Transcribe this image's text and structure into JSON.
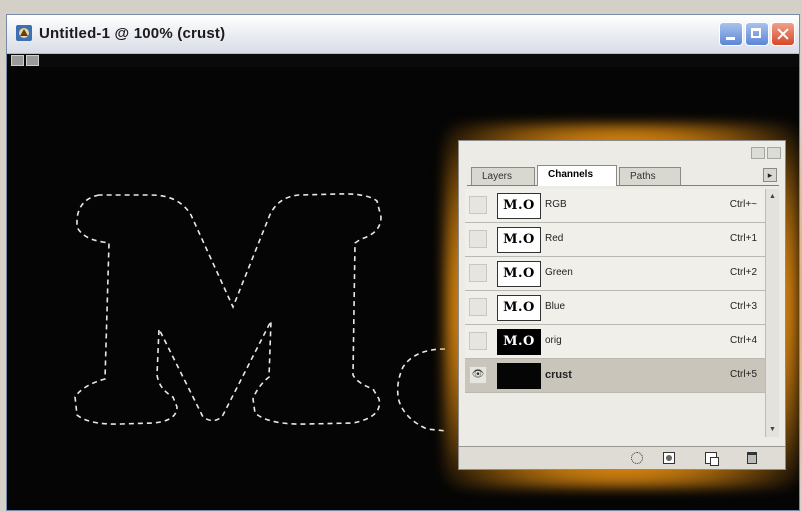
{
  "window": {
    "title": "Untitled-1 @ 100% (crust)",
    "buttons": {
      "minimize": "minimize",
      "maximize": "maximize",
      "close": "close"
    }
  },
  "canvas": {
    "background": "#000000",
    "selection_text": "M.",
    "selection_style": "marching-ants"
  },
  "palette": {
    "accent_glow": "#f29a1c",
    "tabs": [
      {
        "label": "Layers",
        "active": false
      },
      {
        "label": "Channels",
        "active": true
      },
      {
        "label": "Paths",
        "active": false
      }
    ],
    "channels": [
      {
        "thumb": "M.O",
        "name": "RGB",
        "shortcut": "Ctrl+~",
        "visible": false,
        "selected": false
      },
      {
        "thumb": "M.O",
        "name": "Red",
        "shortcut": "Ctrl+1",
        "visible": false,
        "selected": false
      },
      {
        "thumb": "M.O",
        "name": "Green",
        "shortcut": "Ctrl+2",
        "visible": false,
        "selected": false
      },
      {
        "thumb": "M.O",
        "name": "Blue",
        "shortcut": "Ctrl+3",
        "visible": false,
        "selected": false
      },
      {
        "thumb": "M.O",
        "name": "orig",
        "shortcut": "Ctrl+4",
        "visible": false,
        "selected": false
      },
      {
        "thumb": "",
        "name": "crust",
        "shortcut": "Ctrl+5",
        "visible": true,
        "selected": true
      }
    ],
    "bottom_icons": [
      "load-selection-icon",
      "save-selection-icon",
      "new-channel-icon",
      "delete-channel-icon"
    ]
  }
}
